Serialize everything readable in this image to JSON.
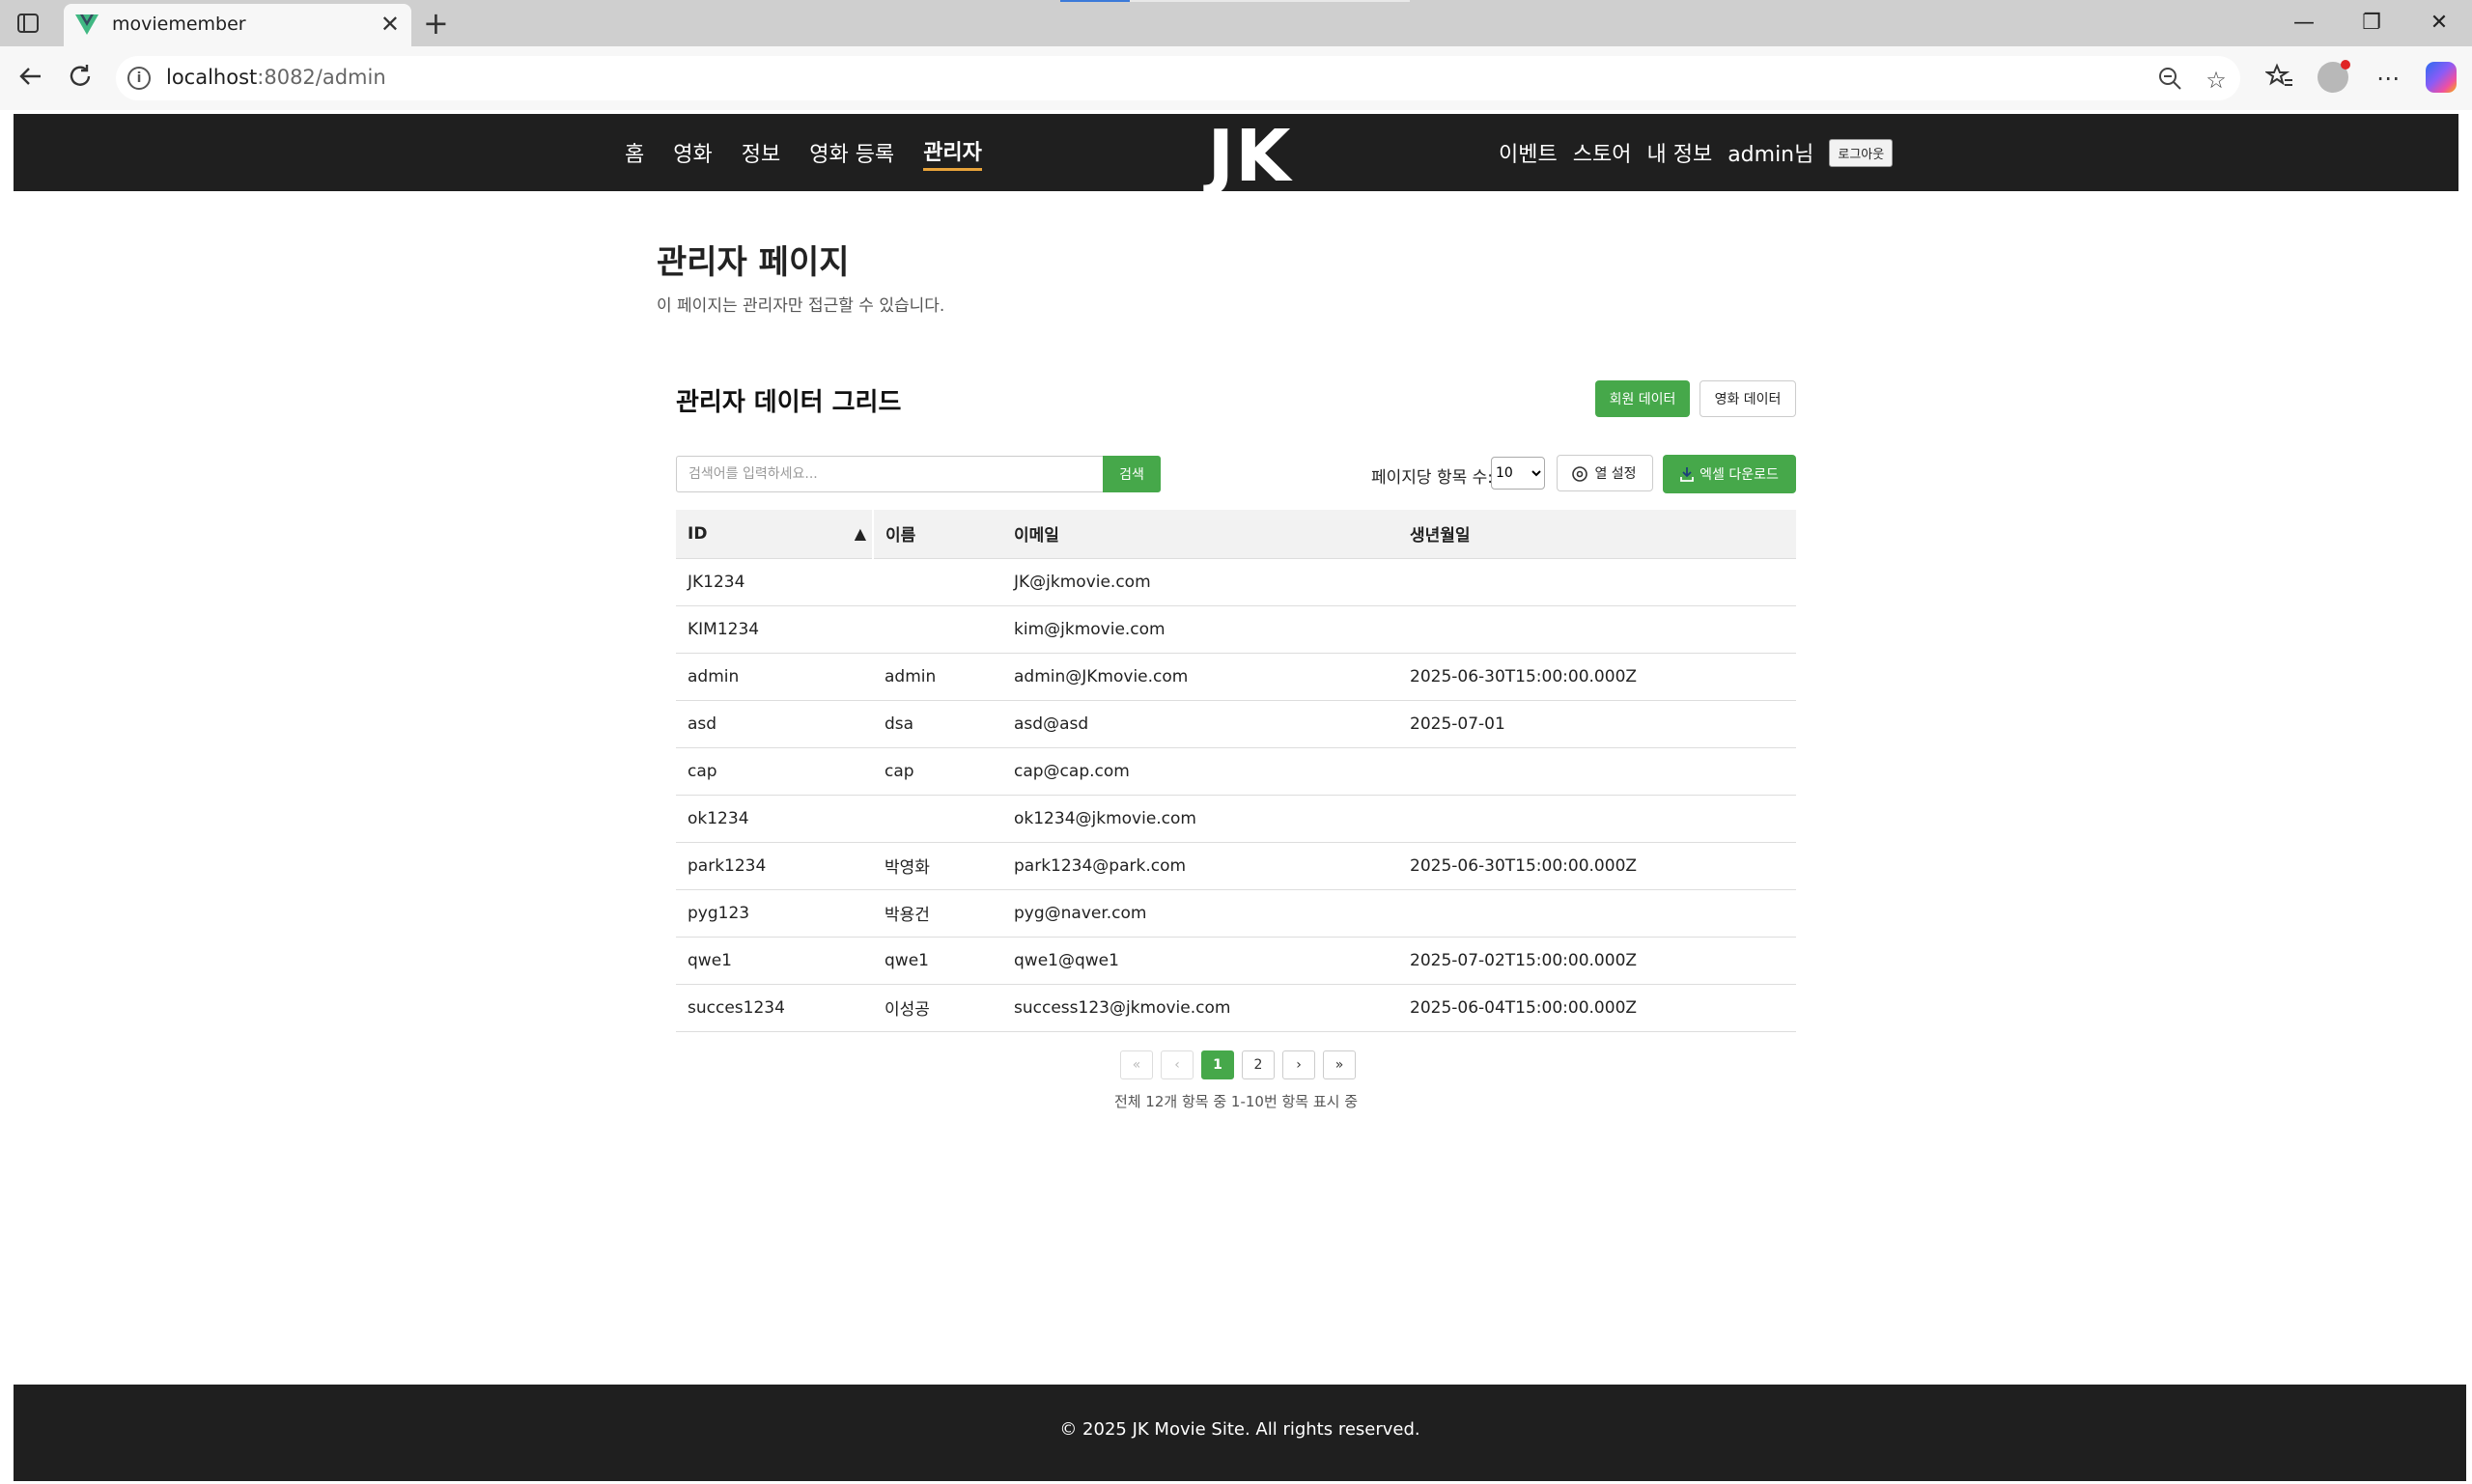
{
  "browser": {
    "tab_title": "moviemember",
    "tab_close": "✕",
    "new_tab": "+",
    "url_host": "localhost",
    "url_rest": ":8082/admin",
    "window_minimize": "—",
    "window_restore": "❐",
    "window_close": "✕"
  },
  "header": {
    "nav_left": [
      "홈",
      "영화",
      "정보",
      "영화 등록",
      "관리자"
    ],
    "active_index": 4,
    "logo": "JK MOVIE",
    "nav_right": [
      "이벤트",
      "스토어",
      "내 정보"
    ],
    "user": "admin님",
    "logout": "로그아웃"
  },
  "page": {
    "title": "관리자 페이지",
    "description": "이 페이지는 관리자만 접근할 수 있습니다."
  },
  "grid": {
    "title": "관리자 데이터 그리드",
    "btn_members": "회원 데이터",
    "btn_movies": "영화 데이터",
    "search_placeholder": "검색어를 입력하세요...",
    "search_button": "검색",
    "per_page_label": "페이지당 항목 수:",
    "per_page_value": "10",
    "column_settings": "열 설정",
    "excel_download": "엑셀 다운로드",
    "columns": [
      "ID",
      "이름",
      "이메일",
      "생년월일"
    ],
    "sort_indicator": "▲",
    "rows": [
      [
        "JK1234",
        "",
        "JK@jkmovie.com",
        ""
      ],
      [
        "KIM1234",
        "",
        "kim@jkmovie.com",
        ""
      ],
      [
        "admin",
        "admin",
        "admin@JKmovie.com",
        "2025-06-30T15:00:00.000Z"
      ],
      [
        "asd",
        "dsa",
        "asd@asd",
        "2025-07-01"
      ],
      [
        "cap",
        "cap",
        "cap@cap.com",
        ""
      ],
      [
        "ok1234",
        "",
        "ok1234@jkmovie.com",
        ""
      ],
      [
        "park1234",
        "박영화",
        "park1234@park.com",
        "2025-06-30T15:00:00.000Z"
      ],
      [
        "pyg123",
        "박용건",
        "pyg@naver.com",
        ""
      ],
      [
        "qwe1",
        "qwe1",
        "qwe1@qwe1",
        "2025-07-02T15:00:00.000Z"
      ],
      [
        "succes1234",
        "이성공",
        "success123@jkmovie.com",
        "2025-06-04T15:00:00.000Z"
      ]
    ],
    "pager": {
      "first": "«",
      "prev": "‹",
      "pages": [
        "1",
        "2"
      ],
      "current": "1",
      "next": "›",
      "last": "»",
      "info": "전체 12개 항목 중 1-10번 항목 표시 중"
    }
  },
  "footer": {
    "copyright": "© 2025 JK Movie Site. All rights reserved."
  },
  "colors": {
    "accent_green": "#46a84a",
    "header_bg": "#1f1f1f",
    "active_underline": "#e8a33a"
  }
}
